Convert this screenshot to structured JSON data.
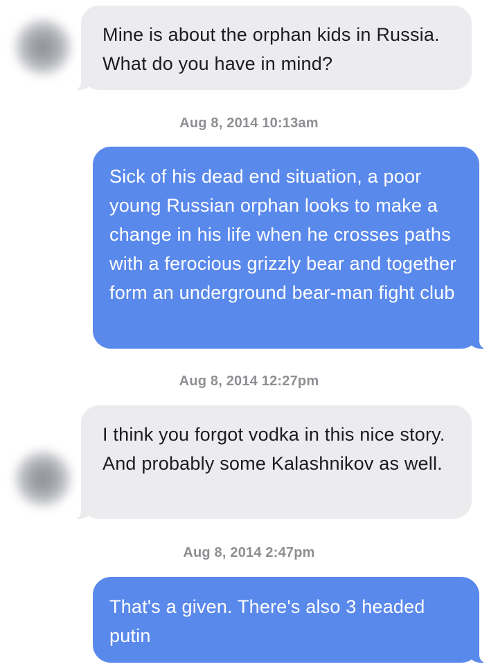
{
  "conversation": {
    "messages": [
      {
        "sender": "other",
        "text": "Mine is about the orphan kids in Russia. What do you have in mind?"
      },
      {
        "sender": "me",
        "text": "Sick of his dead end situation, a poor young Russian orphan looks to make a change in his life when he crosses paths with a ferocious grizzly bear and together form an underground bear-man fight club"
      },
      {
        "sender": "other",
        "text": "I think you forgot vodka in this nice story. And probably some Kalashnikov as well."
      },
      {
        "sender": "me",
        "text": "That's a given. There's also 3 headed putin"
      }
    ],
    "timestamps": [
      "Aug 8, 2014 10:13am",
      "Aug 8, 2014 12:27pm",
      "Aug 8, 2014 2:47pm"
    ]
  },
  "colors": {
    "incoming_bubble": "#ececef",
    "outgoing_bubble": "#5a89ec",
    "timestamp_text": "#8e8e93"
  },
  "icons": {
    "avatar": "blurred-contact-avatar"
  }
}
